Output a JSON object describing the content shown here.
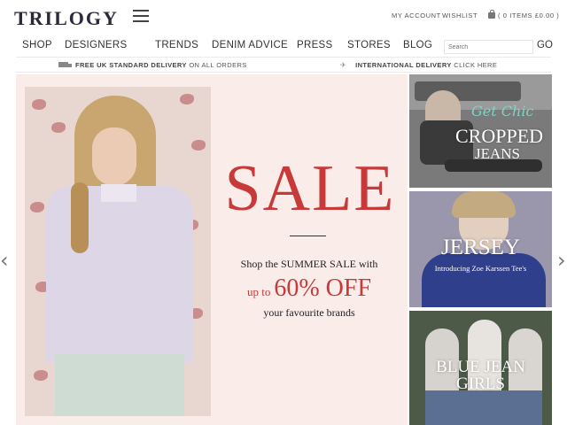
{
  "header": {
    "logo": "TRILOGY",
    "my_account": "MY ACCOUNT",
    "wishlist": "WISHLIST",
    "bag": "( 0 ITEMS £0.00 )"
  },
  "nav": {
    "items": [
      "SHOP",
      "DESIGNERS",
      "TRENDS",
      "DENIM ADVICE",
      "PRESS",
      "STORES",
      "BLOG"
    ],
    "search_placeholder": "Search",
    "go_label": "GO"
  },
  "delivery": {
    "uk_bold": "FREE UK STANDARD DELIVERY",
    "uk_rest": "ON ALL ORDERS",
    "intl_bold": "INTERNATIONAL DELIVERY",
    "intl_rest": "CLICK HERE"
  },
  "hero": {
    "headline": "SALE",
    "line1": "Shop the SUMMER SALE with",
    "line2_small": "up to",
    "line2_big": "60% OFF",
    "line3": "your favourite brands",
    "prev": "‹",
    "next": "›"
  },
  "promos": [
    {
      "script": "Get Chic",
      "title_line1": "CROPPED",
      "title_line2": "JEANS"
    },
    {
      "title": "JERSEY",
      "subtitle": "Introducing Zoe Karssen Tee's"
    },
    {
      "title_line1": "BLUE JEAN",
      "title_line2": "GIRLS"
    }
  ],
  "colors": {
    "accent_red": "#c8393a",
    "hero_bg": "#f9ece9",
    "script_teal": "#7fd3c6"
  }
}
